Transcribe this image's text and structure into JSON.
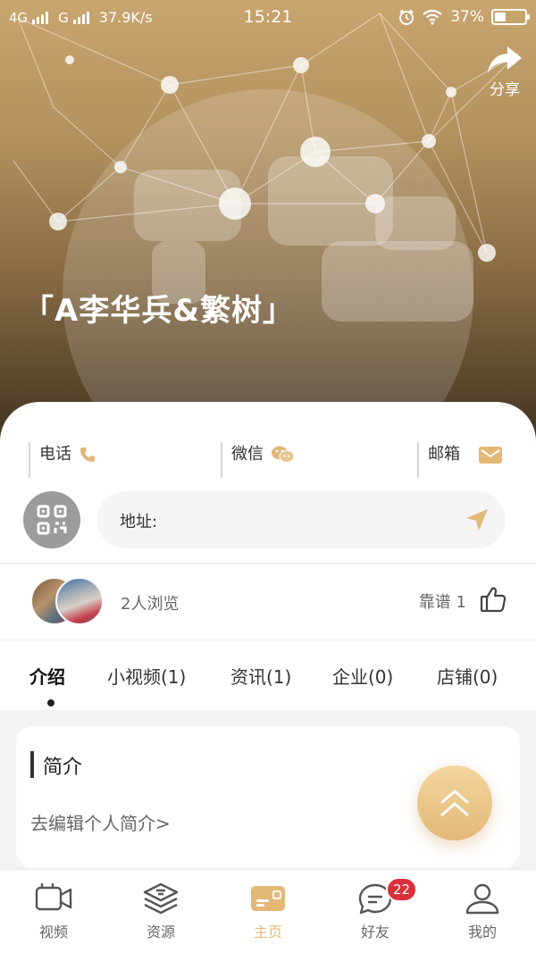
{
  "status_bar": {
    "network1": "4G",
    "network2": "G",
    "speed": "37.9K/s",
    "time": "15:21",
    "battery_text": "37%",
    "battery_level": 0.37
  },
  "hero": {
    "share_label": "分享",
    "title": "「A李华兵&繁树」"
  },
  "contacts": [
    {
      "label": "电话",
      "icon": "phone-icon"
    },
    {
      "label": "微信",
      "icon": "wechat-icon"
    },
    {
      "label": "邮箱",
      "icon": "mail-icon"
    }
  ],
  "address": {
    "label": "地址:"
  },
  "stats": {
    "views": "2人浏览",
    "likes": "靠谱 1"
  },
  "tabs": [
    "介绍",
    "小视频(1)",
    "资讯(1)",
    "企业(0)",
    "店铺(0)"
  ],
  "intro": {
    "title": "简介",
    "edit_link": "去编辑个人简介>"
  },
  "bottom_nav": [
    {
      "label": "视频",
      "icon": "video-icon"
    },
    {
      "label": "资源",
      "icon": "layers-icon"
    },
    {
      "label": "主页",
      "icon": "home-card-icon"
    },
    {
      "label": "好友",
      "icon": "chat-icon",
      "badge": "22"
    },
    {
      "label": "我的",
      "icon": "user-icon"
    }
  ],
  "colors": {
    "accent": "#e2b877",
    "badge": "#d9303a"
  }
}
